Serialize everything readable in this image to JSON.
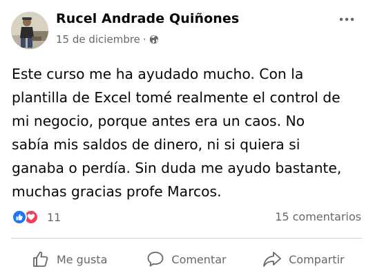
{
  "post": {
    "author": "Rucel Andrade Quiñones",
    "date": "15 de diciembre",
    "separator": "·",
    "text_lines": [
      "Este curso me ha ayudado mucho. Con la",
      "plantilla de Excel tomé realmente el control de",
      "mi negocio, porque antes era un caos. No",
      "sabía mis saldos de dinero, ni si quiera si",
      "ganaba o perdía. Sin duda me ayudo bastante,",
      "muchas gracias profe Marcos."
    ]
  },
  "stats": {
    "reaction_count": "11",
    "comments": "15 comentarios",
    "reaction_types": [
      "like",
      "love"
    ]
  },
  "actions": {
    "like": "Me gusta",
    "comment": "Comentar",
    "share": "Compartir"
  },
  "icons": {
    "privacy": "globe-icon",
    "menu": "more-options-icon"
  },
  "colors": {
    "like_blue": "#1877f2",
    "love_red": "#f33e58",
    "secondary_text": "#65676b"
  }
}
